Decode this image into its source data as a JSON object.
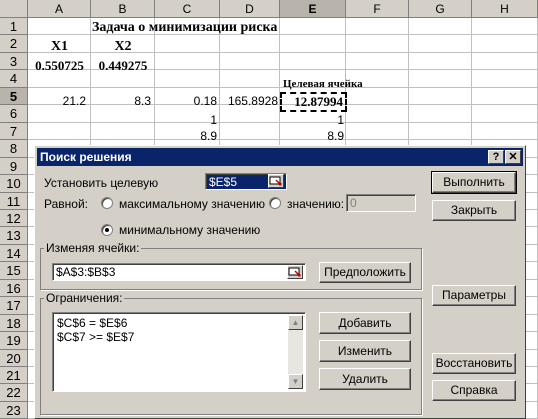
{
  "sheet": {
    "columns": [
      "A",
      "B",
      "C",
      "D",
      "E",
      "F",
      "G",
      "H"
    ],
    "rows": [
      "1",
      "2",
      "3",
      "4",
      "5",
      "6",
      "7",
      "8",
      "9",
      "10",
      "11",
      "12",
      "13",
      "14",
      "15",
      "16",
      "17",
      "18",
      "19",
      "20",
      "21",
      "22",
      "23"
    ],
    "title": "Задача о минимизации риска",
    "x1_label": "X1",
    "x2_label": "X2",
    "a3": "0.550725",
    "b3": "0.449275",
    "e4": "Целевая ячейка",
    "a5": "21.2",
    "b5": "8.3",
    "c5": "0.18",
    "d5": "165.8928",
    "e5": "12.87994",
    "c6": "1",
    "e6": "1",
    "c7": "8.9",
    "e7": "8.9"
  },
  "dialog": {
    "title": "Поиск решения",
    "help_btn": "?",
    "close_btn": "✕",
    "target_label": "Установить целевую",
    "target_value": "$E$5",
    "equal_label": "Равной:",
    "radio_max": "максимальному значению",
    "radio_value": "значению:",
    "value_field": "0",
    "radio_min": "минимальному значению",
    "changing_label": "Изменяя ячейки:",
    "changing_value": "$A$3:$B$3",
    "guess_btn": "Предположить",
    "constraints_label": "Ограничения:",
    "constraints": [
      "$C$6 = $E$6",
      "$C$7 >= $E$7"
    ],
    "add_btn": "Добавить",
    "change_btn": "Изменить",
    "delete_btn": "Удалить",
    "solve_btn": "Выполнить",
    "close_label": "Закрыть",
    "options_btn": "Параметры",
    "reset_btn": "Восстановить",
    "help_label": "Справка"
  }
}
